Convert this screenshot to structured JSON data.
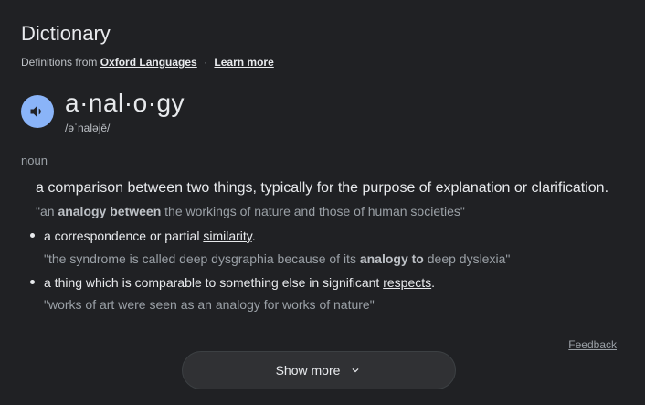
{
  "header": {
    "title": "Dictionary",
    "source_prefix": "Definitions from",
    "source_link": "Oxford Languages",
    "separator": "·",
    "learn_more": "Learn more"
  },
  "entry": {
    "word": "a·nal·o·gy",
    "phonetic": "/əˈnaləjē/",
    "part_of_speech": "noun",
    "speaker_icon": "volume-icon"
  },
  "definitions": {
    "main": {
      "text": "a comparison between two things, typically for the purpose of explanation or clarification.",
      "example_pre": "\"an ",
      "example_bold": "analogy between",
      "example_post": " the workings of nature and those of human societies\""
    },
    "sub": [
      {
        "pre": "a correspondence or partial ",
        "link": "similarity",
        "post": ".",
        "example_pre": "\"the syndrome is called deep dysgraphia because of its ",
        "example_bold": "analogy to",
        "example_post": " deep dyslexia\""
      },
      {
        "pre": "a thing which is comparable to something else in significant ",
        "link": "respects",
        "post": ".",
        "example_pre": "\"works of art were seen as an analogy for works of nature\"",
        "example_bold": "",
        "example_post": ""
      }
    ]
  },
  "footer": {
    "feedback": "Feedback",
    "show_more": "Show more"
  },
  "colors": {
    "background": "#202124",
    "accent": "#8ab4f8"
  }
}
